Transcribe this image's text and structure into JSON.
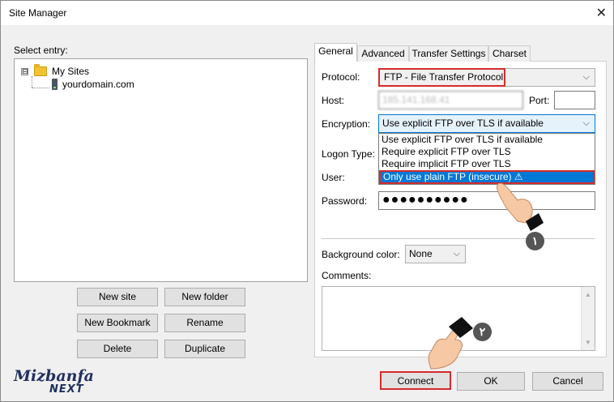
{
  "window": {
    "title": "Site Manager",
    "close_glyph": "✕"
  },
  "left": {
    "select_entry_label": "Select entry:",
    "tree": {
      "root": "My Sites",
      "expander": "⊟",
      "child": "yourdomain.com"
    },
    "buttons": {
      "new_site": "New site",
      "new_folder": "New folder",
      "new_bookmark": "New Bookmark",
      "rename": "Rename",
      "delete": "Delete",
      "duplicate": "Duplicate"
    }
  },
  "tabs": [
    "General",
    "Advanced",
    "Transfer Settings",
    "Charset"
  ],
  "general": {
    "protocol_label": "Protocol:",
    "protocol_value": "FTP - File Transfer Protocol",
    "host_label": "Host:",
    "host_value": "185.141.168.41",
    "port_label": "Port:",
    "port_value": "",
    "encryption_label": "Encryption:",
    "encryption_value": "Use explicit FTP over TLS if available",
    "encryption_options": [
      "Use explicit FTP over TLS if available",
      "Require explicit FTP over TLS",
      "Require implicit FTP over TLS",
      "Only use plain FTP (insecure) ⚠"
    ],
    "logon_type_label": "Logon Type:",
    "user_label": "User:",
    "password_label": "Password:",
    "password_value": "●●●●●●●●●●",
    "bg_color_label": "Background color:",
    "bg_color_value": "None",
    "comments_label": "Comments:"
  },
  "footer": {
    "connect": "Connect",
    "ok": "OK",
    "cancel": "Cancel"
  },
  "logo": {
    "line1": "Mizbanfa",
    "line2": "NEXT"
  },
  "callouts": {
    "step1": "١",
    "step2": "٢"
  },
  "colors": {
    "highlight": "#d62b2b",
    "selection": "#0078d7",
    "logo": "#21305e"
  }
}
